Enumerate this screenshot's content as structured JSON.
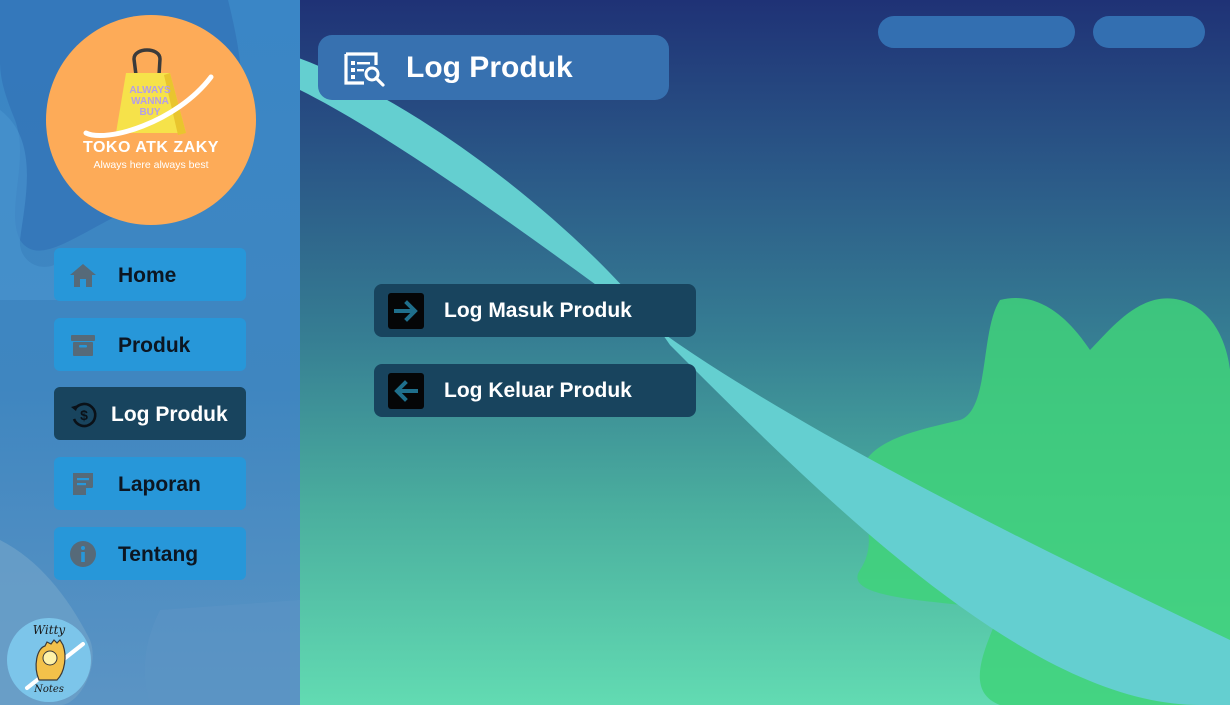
{
  "brand": {
    "bag_text_lines": [
      "ALWAYS",
      "WANNA",
      "BUY"
    ],
    "name": "TOKO ATK ZAKY",
    "tagline": "Always here always best",
    "orange": "#fdab58"
  },
  "sidebar": {
    "items": [
      {
        "label": "Home",
        "icon": "home-icon",
        "active": false
      },
      {
        "label": "Produk",
        "icon": "archive-box-icon",
        "active": false
      },
      {
        "label": "Log Produk",
        "icon": "dollar-history-icon",
        "active": true
      },
      {
        "label": "Laporan",
        "icon": "note-edit-icon",
        "active": false
      },
      {
        "label": "Tentang",
        "icon": "info-icon",
        "active": false
      }
    ],
    "footer_logo": {
      "text_top": "Witty",
      "text_bottom": "Notes"
    }
  },
  "header": {
    "title": "Log Produk",
    "icon": "document-search-icon"
  },
  "actions": [
    {
      "label": "Log Masuk Produk",
      "icon": "arrow-right-icon"
    },
    {
      "label": "Log Keluar Produk",
      "icon": "arrow-left-icon"
    }
  ],
  "colors": {
    "nav_bg": "#2797d9",
    "nav_active_bg": "#18445e",
    "header_card": "#3771b0",
    "top_pill": "#336fb1",
    "ribbon": "#64cfd0",
    "blob_green": "#40d27a"
  }
}
